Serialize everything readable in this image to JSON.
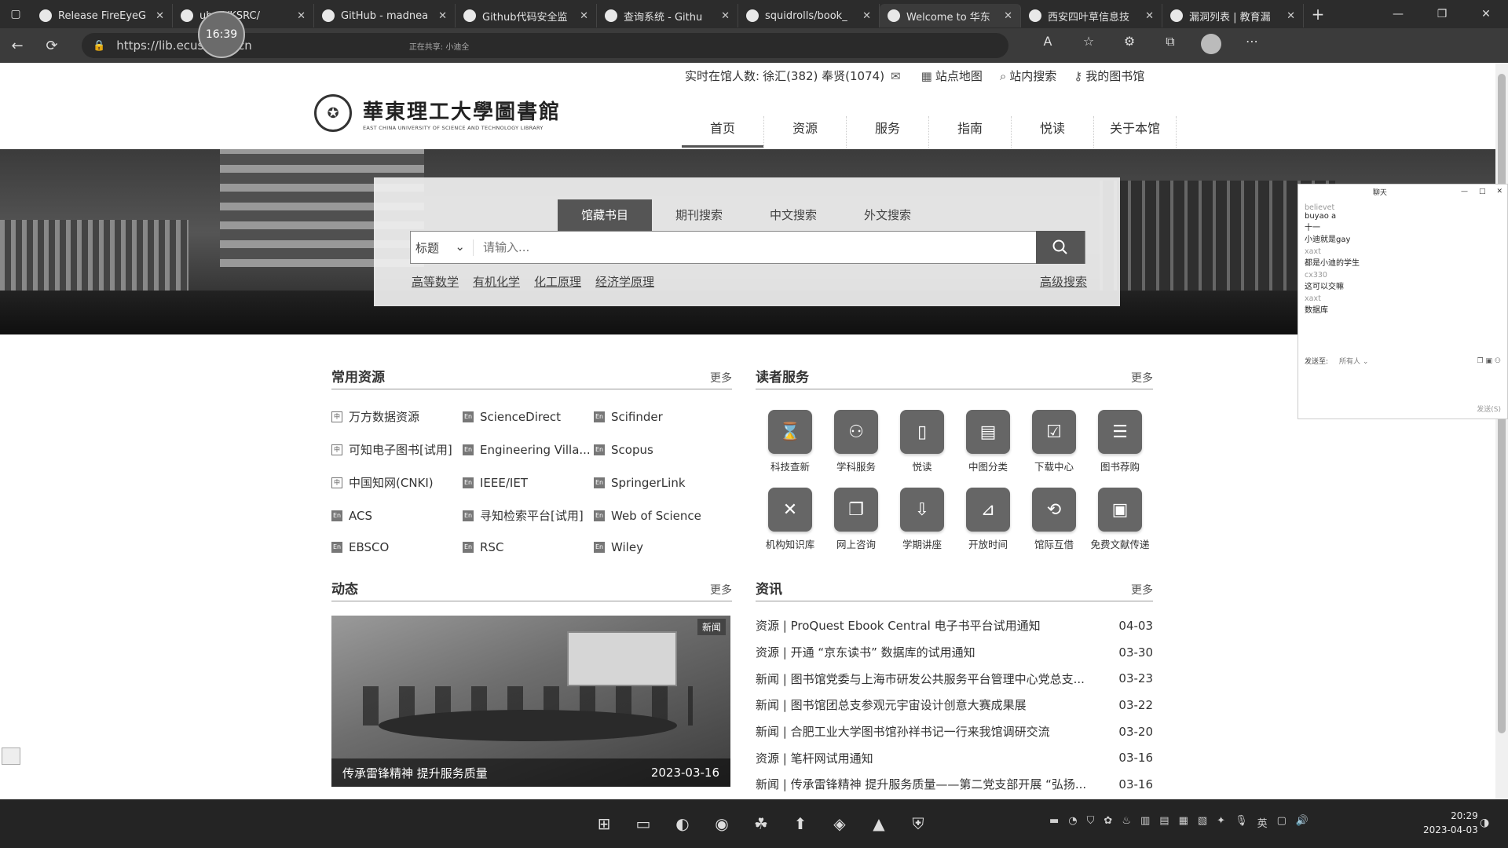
{
  "browser": {
    "tabs": [
      {
        "title": "Release FireEyeG",
        "active": false
      },
      {
        "title": "ub - VKSRC/",
        "active": false
      },
      {
        "title": "GitHub - madnea",
        "active": false
      },
      {
        "title": "Github代码安全监",
        "active": false
      },
      {
        "title": "查询系统 - Githu",
        "active": false
      },
      {
        "title": "squidrolls/book_",
        "active": false
      },
      {
        "title": "Welcome to 华东",
        "active": true
      },
      {
        "title": "西安四叶草信息技",
        "active": false
      },
      {
        "title": "漏洞列表 | 教育漏",
        "active": false
      }
    ],
    "new_tab": "+",
    "url": "https://lib.ecust.edu.cn",
    "mini_status": "正在共享: 小迪全",
    "timer": "16:39"
  },
  "site": {
    "topbar": {
      "online_label": "实时在馆人数:",
      "online_value": "徐汇(382) 奉贤(1074)",
      "sitemap": "站点地图",
      "site_search": "站内搜索",
      "my_library": "我的图书馆"
    },
    "logo": {
      "cn": "華東理工大學圖書館",
      "en": "EAST CHINA UNIVERSITY OF SCIENCE AND TECHNOLOGY LIBRARY"
    },
    "nav": [
      "首页",
      "资源",
      "服务",
      "指南",
      "悦读",
      "关于本馆"
    ],
    "search": {
      "tabs": [
        "馆藏书目",
        "期刊搜索",
        "中文搜索",
        "外文搜索"
      ],
      "field": "标题",
      "placeholder": "请输入...",
      "hot_words": [
        "高等数学",
        "有机化学",
        "化工原理",
        "经济学原理"
      ],
      "advanced": "高级搜索"
    },
    "resources": {
      "title": "常用资源",
      "more": "更多",
      "items": [
        {
          "label": "万方数据资源",
          "badge": "中"
        },
        {
          "label": "ScienceDirect",
          "badge": "En"
        },
        {
          "label": "Scifinder",
          "badge": "En"
        },
        {
          "label": "可知电子图书[试用]",
          "badge": "中"
        },
        {
          "label": "Engineering Villa...",
          "badge": "En"
        },
        {
          "label": "Scopus",
          "badge": "En"
        },
        {
          "label": "中国知网(CNKI)",
          "badge": "中"
        },
        {
          "label": "IEEE/IET",
          "badge": "En"
        },
        {
          "label": "SpringerLink",
          "badge": "En"
        },
        {
          "label": "ACS",
          "badge": "En"
        },
        {
          "label": "寻知检索平台[试用]",
          "badge": "En"
        },
        {
          "label": "Web of Science",
          "badge": "En"
        },
        {
          "label": "EBSCO",
          "badge": "En"
        },
        {
          "label": "RSC",
          "badge": "En"
        },
        {
          "label": "Wiley",
          "badge": "En"
        }
      ]
    },
    "services": {
      "title": "读者服务",
      "more": "更多",
      "items": [
        {
          "label": "科技查新",
          "icon": "⌛"
        },
        {
          "label": "学科服务",
          "icon": "⚇"
        },
        {
          "label": "悦读",
          "icon": "▯"
        },
        {
          "label": "中图分类",
          "icon": "▤"
        },
        {
          "label": "下载中心",
          "icon": "☑"
        },
        {
          "label": "图书荐购",
          "icon": "☰"
        },
        {
          "label": "机构知识库",
          "icon": "✕"
        },
        {
          "label": "网上咨询",
          "icon": "❐"
        },
        {
          "label": "学期讲座",
          "icon": "⇩"
        },
        {
          "label": "开放时间",
          "icon": "⊿"
        },
        {
          "label": "馆际互借",
          "icon": "⟲"
        },
        {
          "label": "免费文献传递",
          "icon": "▣"
        }
      ]
    },
    "news": {
      "title": "动态",
      "more": "更多",
      "tag": "新闻",
      "caption": "传承雷锋精神 提升服务质量",
      "date": "2023-03-16"
    },
    "info": {
      "title": "资讯",
      "more": "更多",
      "items": [
        {
          "text": "资源 | ProQuest Ebook Central 电子书平台试用通知",
          "date": "04-03"
        },
        {
          "text": "资源 | 开通 “京东读书” 数据库的试用通知",
          "date": "03-30"
        },
        {
          "text": "新闻 | 图书馆党委与上海市研发公共服务平台管理中心党总支...",
          "date": "03-23"
        },
        {
          "text": "新闻 | 图书馆团总支参观元宇宙设计创意大赛成果展",
          "date": "03-22"
        },
        {
          "text": "新闻 | 合肥工业大学图书馆孙祥书记一行来我馆调研交流",
          "date": "03-20"
        },
        {
          "text": "资源 | 笔杆网试用通知",
          "date": "03-16"
        },
        {
          "text": "新闻 | 传承雷锋精神 提升服务质量——第二党支部开展 “弘扬...",
          "date": "03-16"
        }
      ]
    }
  },
  "chat": {
    "title": "聊天",
    "messages": [
      {
        "name": "believet",
        "text": "buyao a"
      },
      {
        "name": "",
        "text": "十一"
      },
      {
        "name": "",
        "text": "小迪就是gay"
      },
      {
        "name": "xaxt",
        "text": "都是小迪的学生"
      },
      {
        "name": "cx330",
        "text": "这可以交嘛"
      },
      {
        "name": "xaxt",
        "text": "数据库"
      }
    ],
    "send_to_label": "发送至:",
    "send_to_value": "所有人",
    "send_button": "发送(S)"
  },
  "taskbar": {
    "tray_lang": "英",
    "time": "20:29",
    "date": "2023-04-03"
  },
  "colors": {
    "accent": "#555555",
    "page_bg": "#ffffff",
    "chrome_bg": "#2c2c2c"
  }
}
